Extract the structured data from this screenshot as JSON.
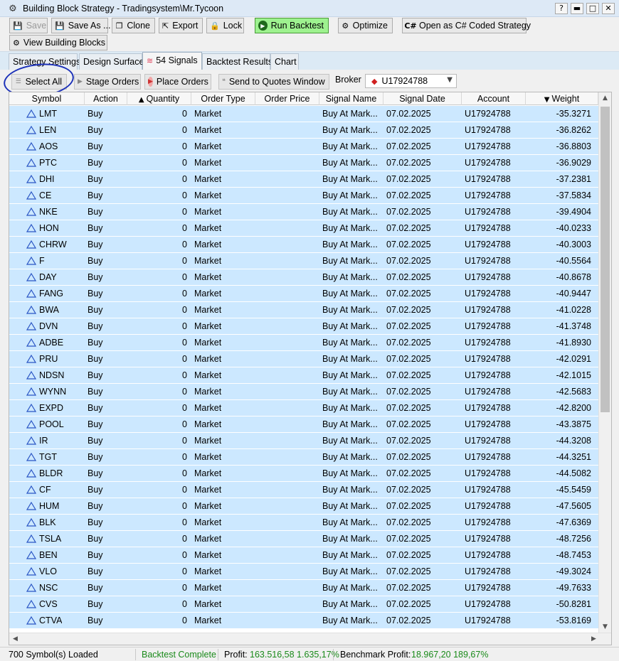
{
  "window": {
    "title": "Building Block Strategy - Tradingsystem\\Mr.Tycoon",
    "controls": [
      "?",
      "▬",
      "□",
      "✕"
    ]
  },
  "toolbar": {
    "save": "Save",
    "save_as": "Save As ...",
    "clone": "Clone",
    "export": "Export",
    "lock": "Lock",
    "run_backtest": "Run Backtest",
    "optimize": "Optimize",
    "open_cs": "Open as C# Coded Strategy",
    "view_blocks": "View Building Blocks"
  },
  "tabs": [
    "Strategy Settings",
    "Design Surface",
    "54 Signals",
    "Backtest Results",
    "Chart"
  ],
  "signals_toolbar": {
    "select_all": "Select All",
    "stage_orders": "Stage Orders",
    "place_orders": "Place Orders",
    "send_quotes": "Send to Quotes Window",
    "broker_label": "Broker",
    "broker_value": "U17924788"
  },
  "columns": [
    "Symbol",
    "Action",
    "Quantity",
    "Order Type",
    "Order Price",
    "Signal Name",
    "Signal Date",
    "Account",
    "Weight"
  ],
  "rows": [
    {
      "symbol": "LMT",
      "action": "Buy",
      "quantity": "0",
      "order_type": "Market",
      "signal_name": "Buy At Mark...",
      "signal_date": "07.02.2025",
      "account": "U17924788",
      "weight": "-35.3271"
    },
    {
      "symbol": "LEN",
      "action": "Buy",
      "quantity": "0",
      "order_type": "Market",
      "signal_name": "Buy At Mark...",
      "signal_date": "07.02.2025",
      "account": "U17924788",
      "weight": "-36.8262"
    },
    {
      "symbol": "AOS",
      "action": "Buy",
      "quantity": "0",
      "order_type": "Market",
      "signal_name": "Buy At Mark...",
      "signal_date": "07.02.2025",
      "account": "U17924788",
      "weight": "-36.8803"
    },
    {
      "symbol": "PTC",
      "action": "Buy",
      "quantity": "0",
      "order_type": "Market",
      "signal_name": "Buy At Mark...",
      "signal_date": "07.02.2025",
      "account": "U17924788",
      "weight": "-36.9029"
    },
    {
      "symbol": "DHI",
      "action": "Buy",
      "quantity": "0",
      "order_type": "Market",
      "signal_name": "Buy At Mark...",
      "signal_date": "07.02.2025",
      "account": "U17924788",
      "weight": "-37.2381"
    },
    {
      "symbol": "CE",
      "action": "Buy",
      "quantity": "0",
      "order_type": "Market",
      "signal_name": "Buy At Mark...",
      "signal_date": "07.02.2025",
      "account": "U17924788",
      "weight": "-37.5834"
    },
    {
      "symbol": "NKE",
      "action": "Buy",
      "quantity": "0",
      "order_type": "Market",
      "signal_name": "Buy At Mark...",
      "signal_date": "07.02.2025",
      "account": "U17924788",
      "weight": "-39.4904"
    },
    {
      "symbol": "HON",
      "action": "Buy",
      "quantity": "0",
      "order_type": "Market",
      "signal_name": "Buy At Mark...",
      "signal_date": "07.02.2025",
      "account": "U17924788",
      "weight": "-40.0233"
    },
    {
      "symbol": "CHRW",
      "action": "Buy",
      "quantity": "0",
      "order_type": "Market",
      "signal_name": "Buy At Mark...",
      "signal_date": "07.02.2025",
      "account": "U17924788",
      "weight": "-40.3003"
    },
    {
      "symbol": "F",
      "action": "Buy",
      "quantity": "0",
      "order_type": "Market",
      "signal_name": "Buy At Mark...",
      "signal_date": "07.02.2025",
      "account": "U17924788",
      "weight": "-40.5564"
    },
    {
      "symbol": "DAY",
      "action": "Buy",
      "quantity": "0",
      "order_type": "Market",
      "signal_name": "Buy At Mark...",
      "signal_date": "07.02.2025",
      "account": "U17924788",
      "weight": "-40.8678"
    },
    {
      "symbol": "FANG",
      "action": "Buy",
      "quantity": "0",
      "order_type": "Market",
      "signal_name": "Buy At Mark...",
      "signal_date": "07.02.2025",
      "account": "U17924788",
      "weight": "-40.9447"
    },
    {
      "symbol": "BWA",
      "action": "Buy",
      "quantity": "0",
      "order_type": "Market",
      "signal_name": "Buy At Mark...",
      "signal_date": "07.02.2025",
      "account": "U17924788",
      "weight": "-41.0228"
    },
    {
      "symbol": "DVN",
      "action": "Buy",
      "quantity": "0",
      "order_type": "Market",
      "signal_name": "Buy At Mark...",
      "signal_date": "07.02.2025",
      "account": "U17924788",
      "weight": "-41.3748"
    },
    {
      "symbol": "ADBE",
      "action": "Buy",
      "quantity": "0",
      "order_type": "Market",
      "signal_name": "Buy At Mark...",
      "signal_date": "07.02.2025",
      "account": "U17924788",
      "weight": "-41.8930"
    },
    {
      "symbol": "PRU",
      "action": "Buy",
      "quantity": "0",
      "order_type": "Market",
      "signal_name": "Buy At Mark...",
      "signal_date": "07.02.2025",
      "account": "U17924788",
      "weight": "-42.0291"
    },
    {
      "symbol": "NDSN",
      "action": "Buy",
      "quantity": "0",
      "order_type": "Market",
      "signal_name": "Buy At Mark...",
      "signal_date": "07.02.2025",
      "account": "U17924788",
      "weight": "-42.1015"
    },
    {
      "symbol": "WYNN",
      "action": "Buy",
      "quantity": "0",
      "order_type": "Market",
      "signal_name": "Buy At Mark...",
      "signal_date": "07.02.2025",
      "account": "U17924788",
      "weight": "-42.5683"
    },
    {
      "symbol": "EXPD",
      "action": "Buy",
      "quantity": "0",
      "order_type": "Market",
      "signal_name": "Buy At Mark...",
      "signal_date": "07.02.2025",
      "account": "U17924788",
      "weight": "-42.8200"
    },
    {
      "symbol": "POOL",
      "action": "Buy",
      "quantity": "0",
      "order_type": "Market",
      "signal_name": "Buy At Mark...",
      "signal_date": "07.02.2025",
      "account": "U17924788",
      "weight": "-43.3875"
    },
    {
      "symbol": "IR",
      "action": "Buy",
      "quantity": "0",
      "order_type": "Market",
      "signal_name": "Buy At Mark...",
      "signal_date": "07.02.2025",
      "account": "U17924788",
      "weight": "-44.3208"
    },
    {
      "symbol": "TGT",
      "action": "Buy",
      "quantity": "0",
      "order_type": "Market",
      "signal_name": "Buy At Mark...",
      "signal_date": "07.02.2025",
      "account": "U17924788",
      "weight": "-44.3251"
    },
    {
      "symbol": "BLDR",
      "action": "Buy",
      "quantity": "0",
      "order_type": "Market",
      "signal_name": "Buy At Mark...",
      "signal_date": "07.02.2025",
      "account": "U17924788",
      "weight": "-44.5082"
    },
    {
      "symbol": "CF",
      "action": "Buy",
      "quantity": "0",
      "order_type": "Market",
      "signal_name": "Buy At Mark...",
      "signal_date": "07.02.2025",
      "account": "U17924788",
      "weight": "-45.5459"
    },
    {
      "symbol": "HUM",
      "action": "Buy",
      "quantity": "0",
      "order_type": "Market",
      "signal_name": "Buy At Mark...",
      "signal_date": "07.02.2025",
      "account": "U17924788",
      "weight": "-47.5605"
    },
    {
      "symbol": "BLK",
      "action": "Buy",
      "quantity": "0",
      "order_type": "Market",
      "signal_name": "Buy At Mark...",
      "signal_date": "07.02.2025",
      "account": "U17924788",
      "weight": "-47.6369"
    },
    {
      "symbol": "TSLA",
      "action": "Buy",
      "quantity": "0",
      "order_type": "Market",
      "signal_name": "Buy At Mark...",
      "signal_date": "07.02.2025",
      "account": "U17924788",
      "weight": "-48.7256"
    },
    {
      "symbol": "BEN",
      "action": "Buy",
      "quantity": "0",
      "order_type": "Market",
      "signal_name": "Buy At Mark...",
      "signal_date": "07.02.2025",
      "account": "U17924788",
      "weight": "-48.7453"
    },
    {
      "symbol": "VLO",
      "action": "Buy",
      "quantity": "0",
      "order_type": "Market",
      "signal_name": "Buy At Mark...",
      "signal_date": "07.02.2025",
      "account": "U17924788",
      "weight": "-49.3024"
    },
    {
      "symbol": "NSC",
      "action": "Buy",
      "quantity": "0",
      "order_type": "Market",
      "signal_name": "Buy At Mark...",
      "signal_date": "07.02.2025",
      "account": "U17924788",
      "weight": "-49.7633"
    },
    {
      "symbol": "CVS",
      "action": "Buy",
      "quantity": "0",
      "order_type": "Market",
      "signal_name": "Buy At Mark...",
      "signal_date": "07.02.2025",
      "account": "U17924788",
      "weight": "-50.8281"
    },
    {
      "symbol": "CTVA",
      "action": "Buy",
      "quantity": "0",
      "order_type": "Market",
      "signal_name": "Buy At Mark...",
      "signal_date": "07.02.2025",
      "account": "U17924788",
      "weight": "-53.8169"
    }
  ],
  "status": {
    "loaded": "700 Symbol(s) Loaded",
    "backtest": "Backtest Complete",
    "profit_label": "Profit:",
    "profit_value": "163.516,58 1.635,17%",
    "benchmark_label": "Benchmark Profit:",
    "benchmark_value": "18.967,20 189,67%"
  },
  "colors": {
    "row_selected": "#cce8ff",
    "run_button": "#9ef28f",
    "status_green": "#1a8a1a",
    "annotation": "#1b30b8"
  }
}
